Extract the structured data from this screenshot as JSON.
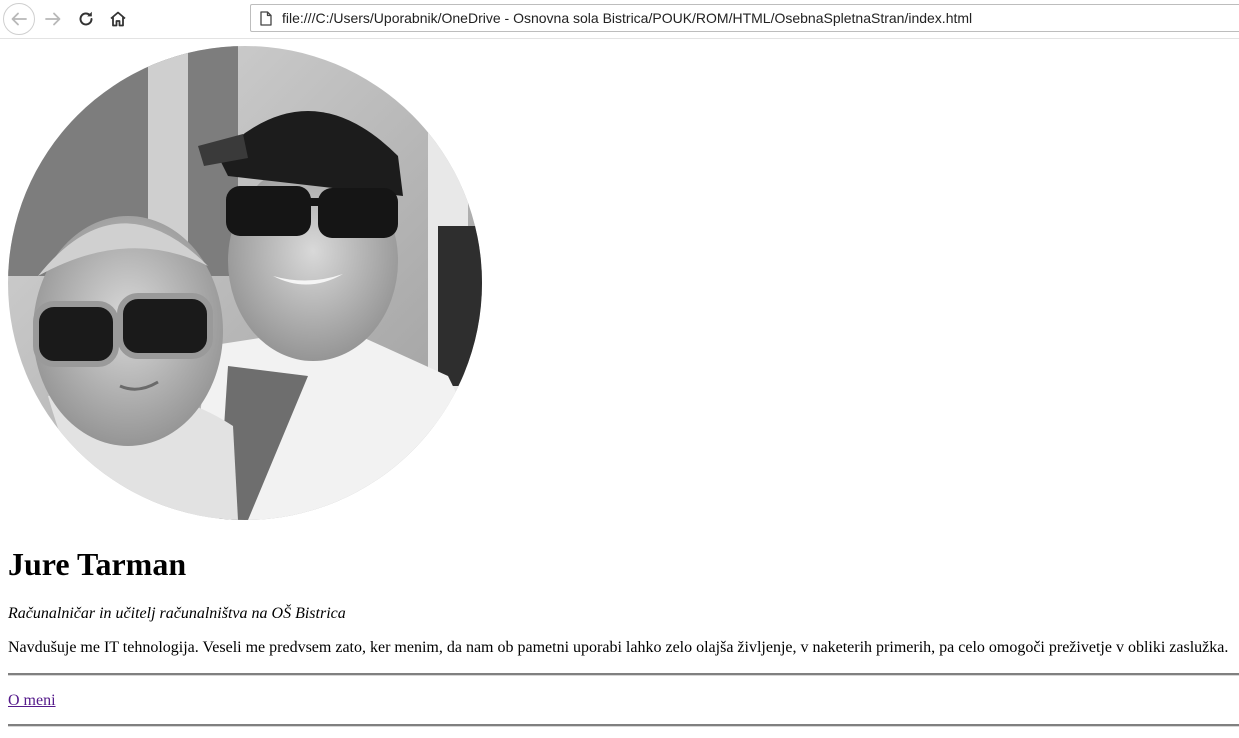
{
  "browser": {
    "url": "file:///C:/Users/Uporabnik/OneDrive - Osnovna sola Bistrica/POUK/ROM/HTML/OsebnaSpletnaStran/index.html",
    "icons": {
      "back": "arrow-left-icon",
      "forward": "arrow-right-icon",
      "reload": "reload-icon",
      "home": "home-icon",
      "page": "page-icon"
    }
  },
  "profile": {
    "name": "Jure Tarman",
    "subtitle": "Računalničar in učitelj računalništva na OŠ Bistrica",
    "bio": "Navdušuje me IT tehnologija. Veseli me predvsem zato, ker menim, da nam ob pametni uporabi lahko zelo olajša življenje, v naketerih primerih, pa celo omogoči preživetje v obliki zaslužka.",
    "link_label": "O meni"
  },
  "colors": {
    "visited_link": "#551a8b",
    "rule": "#808080"
  }
}
